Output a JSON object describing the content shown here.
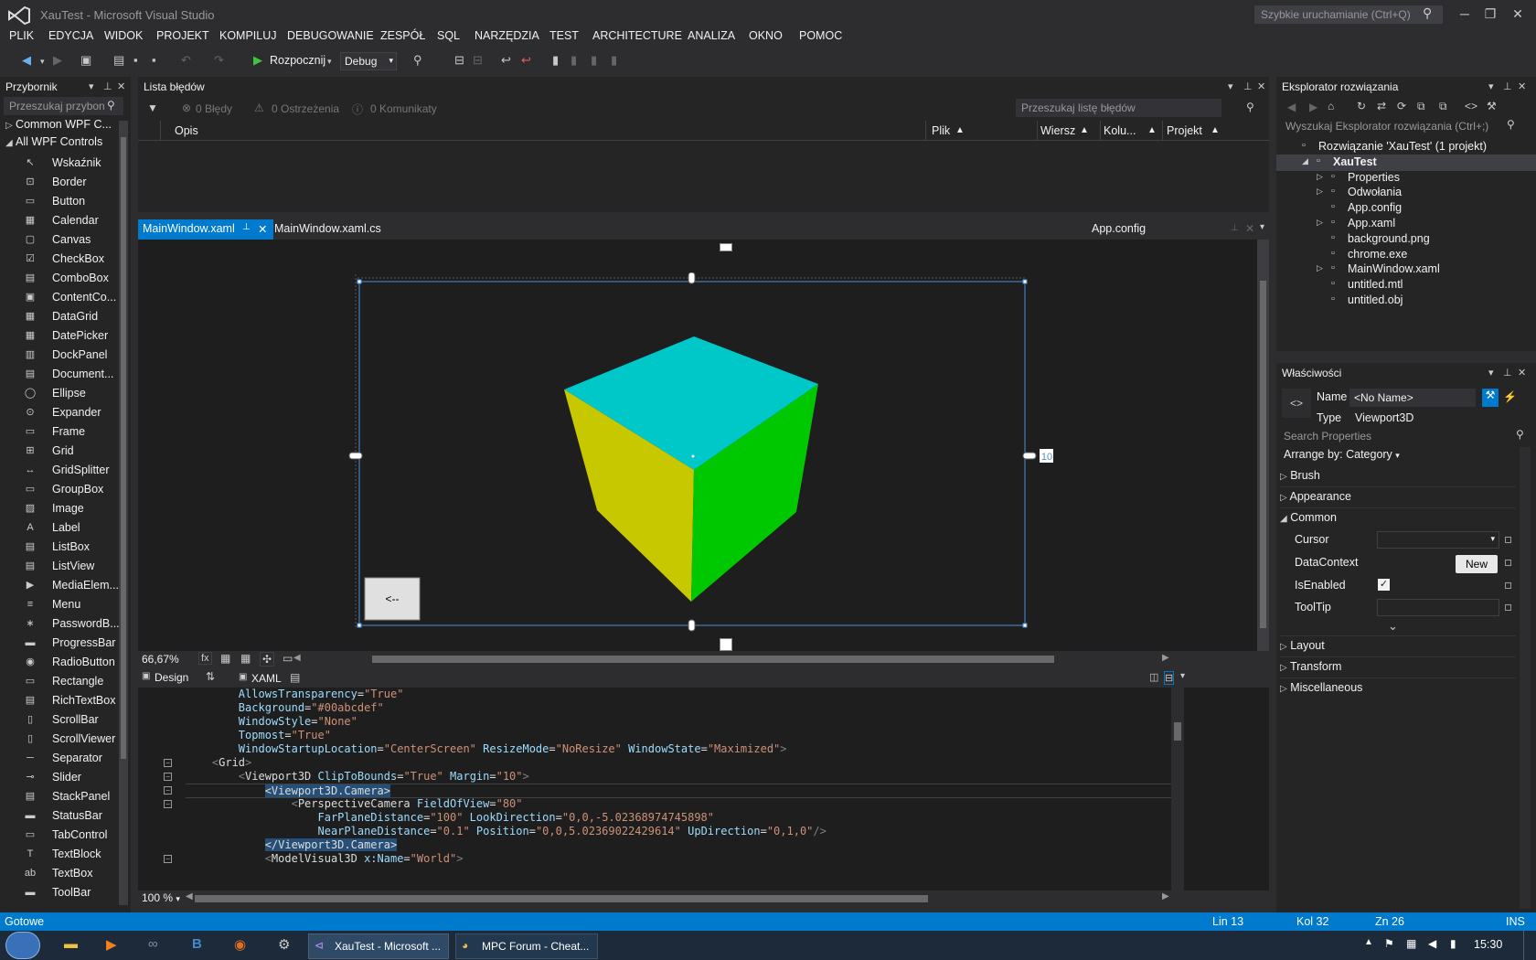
{
  "window": {
    "title": "XauTest - Microsoft Visual Studio",
    "quick_launch": "Szybkie uruchamianie (Ctrl+Q)"
  },
  "menu": [
    "PLIK",
    "EDYCJA",
    "WIDOK",
    "PROJEKT",
    "KOMPILUJ",
    "DEBUGOWANIE",
    "ZESPÓŁ",
    "SQL",
    "NARZĘDZIA",
    "TEST",
    "ARCHITECTURE",
    "ANALIZA",
    "OKNO",
    "POMOC"
  ],
  "toolbar": {
    "start_label": "Rozpocznij",
    "config": "Debug"
  },
  "toolbox": {
    "title": "Przybornik",
    "search_placeholder": "Przeszukaj przybon",
    "groups": [
      "Common WPF C...",
      "All WPF Controls"
    ],
    "items": [
      {
        "label": "Wskaźnik",
        "icon": "pointer-icon",
        "glyph": "↖"
      },
      {
        "label": "Border",
        "icon": "border-icon",
        "glyph": "⊡"
      },
      {
        "label": "Button",
        "icon": "button-icon",
        "glyph": "▭"
      },
      {
        "label": "Calendar",
        "icon": "calendar-icon",
        "glyph": "▦"
      },
      {
        "label": "Canvas",
        "icon": "canvas-icon",
        "glyph": "▢"
      },
      {
        "label": "CheckBox",
        "icon": "checkbox-icon",
        "glyph": "☑"
      },
      {
        "label": "ComboBox",
        "icon": "combobox-icon",
        "glyph": "▤"
      },
      {
        "label": "ContentCo...",
        "icon": "contentcontrol-icon",
        "glyph": "▣"
      },
      {
        "label": "DataGrid",
        "icon": "datagrid-icon",
        "glyph": "▦"
      },
      {
        "label": "DatePicker",
        "icon": "datepicker-icon",
        "glyph": "▦"
      },
      {
        "label": "DockPanel",
        "icon": "dockpanel-icon",
        "glyph": "▥"
      },
      {
        "label": "Document...",
        "icon": "document-icon",
        "glyph": "▤"
      },
      {
        "label": "Ellipse",
        "icon": "ellipse-icon",
        "glyph": "◯"
      },
      {
        "label": "Expander",
        "icon": "expander-icon",
        "glyph": "⊙"
      },
      {
        "label": "Frame",
        "icon": "frame-icon",
        "glyph": "▭"
      },
      {
        "label": "Grid",
        "icon": "grid-icon",
        "glyph": "⊞"
      },
      {
        "label": "GridSplitter",
        "icon": "gridsplitter-icon",
        "glyph": "↔"
      },
      {
        "label": "GroupBox",
        "icon": "groupbox-icon",
        "glyph": "▭"
      },
      {
        "label": "Image",
        "icon": "image-icon",
        "glyph": "▨"
      },
      {
        "label": "Label",
        "icon": "label-icon",
        "glyph": "A"
      },
      {
        "label": "ListBox",
        "icon": "listbox-icon",
        "glyph": "▤"
      },
      {
        "label": "ListView",
        "icon": "listview-icon",
        "glyph": "▤"
      },
      {
        "label": "MediaElem...",
        "icon": "mediaelement-icon",
        "glyph": "▶"
      },
      {
        "label": "Menu",
        "icon": "menu-icon",
        "glyph": "≡"
      },
      {
        "label": "PasswordB...",
        "icon": "passwordbox-icon",
        "glyph": "∗"
      },
      {
        "label": "ProgressBar",
        "icon": "progressbar-icon",
        "glyph": "▬"
      },
      {
        "label": "RadioButton",
        "icon": "radiobutton-icon",
        "glyph": "◉"
      },
      {
        "label": "Rectangle",
        "icon": "rectangle-icon",
        "glyph": "▭"
      },
      {
        "label": "RichTextBox",
        "icon": "richtextbox-icon",
        "glyph": "▤"
      },
      {
        "label": "ScrollBar",
        "icon": "scrollbar-icon",
        "glyph": "▯"
      },
      {
        "label": "ScrollViewer",
        "icon": "scrollviewer-icon",
        "glyph": "▯"
      },
      {
        "label": "Separator",
        "icon": "separator-icon",
        "glyph": "─"
      },
      {
        "label": "Slider",
        "icon": "slider-icon",
        "glyph": "⊸"
      },
      {
        "label": "StackPanel",
        "icon": "stackpanel-icon",
        "glyph": "▤"
      },
      {
        "label": "StatusBar",
        "icon": "statusbar-icon",
        "glyph": "▬"
      },
      {
        "label": "TabControl",
        "icon": "tabcontrol-icon",
        "glyph": "▭"
      },
      {
        "label": "TextBlock",
        "icon": "textblock-icon",
        "glyph": "T"
      },
      {
        "label": "TextBox",
        "icon": "textbox-icon",
        "glyph": "ab"
      },
      {
        "label": "ToolBar",
        "icon": "toolbar-icon",
        "glyph": "▬"
      }
    ]
  },
  "error_list": {
    "title": "Lista błędów",
    "errors": "0 Błędy",
    "warnings": "0 Ostrzeżenia",
    "messages": "0 Komunikaty",
    "search_placeholder": "Przeszukaj listę błędów",
    "columns": [
      "Opis",
      "Plik",
      "Wiersz",
      "Kolu...",
      "Projekt"
    ]
  },
  "tabs": {
    "active": "MainWindow.xaml",
    "second": "MainWindow.xaml.cs",
    "right": "App.config"
  },
  "designer": {
    "margin_left": "10",
    "margin_right": "10",
    "button_label": "<--",
    "zoom": "66,67%"
  },
  "colors": {
    "cube_top": "#00c8c8",
    "cube_left": "#c8c800",
    "cube_right": "#00c800",
    "accent": "#007acc"
  },
  "split": {
    "design": "Design",
    "xaml": "XAML"
  },
  "xaml_lines": [
    [
      [
        "a",
        "        AllowsTransparency"
      ],
      [
        "t",
        "="
      ],
      [
        "v",
        "\"True\""
      ]
    ],
    [
      [
        "a",
        "        Background"
      ],
      [
        "t",
        "="
      ],
      [
        "v",
        "\"#00abcdef\""
      ]
    ],
    [
      [
        "a",
        "        WindowStyle"
      ],
      [
        "t",
        "="
      ],
      [
        "v",
        "\"None\""
      ]
    ],
    [
      [
        "a",
        "        Topmost"
      ],
      [
        "t",
        "="
      ],
      [
        "v",
        "\"True\""
      ]
    ],
    [
      [
        "a",
        "        WindowStartupLocation"
      ],
      [
        "t",
        "="
      ],
      [
        "v",
        "\"CenterScreen\""
      ],
      [
        "a",
        " ResizeMode"
      ],
      [
        "t",
        "="
      ],
      [
        "v",
        "\"NoResize\""
      ],
      [
        "a",
        " WindowState"
      ],
      [
        "t",
        "="
      ],
      [
        "v",
        "\"Maximized\""
      ],
      [
        "g",
        ">"
      ]
    ],
    [
      [
        "g",
        "    <"
      ],
      [
        "e",
        "Grid"
      ],
      [
        "g",
        ">"
      ]
    ],
    [
      [
        "g",
        "        <"
      ],
      [
        "e",
        "Viewport3D"
      ],
      [
        "a",
        " ClipToBounds"
      ],
      [
        "t",
        "="
      ],
      [
        "v",
        "\"True\""
      ],
      [
        "a",
        " Margin"
      ],
      [
        "t",
        "="
      ],
      [
        "v",
        "\"10\""
      ],
      [
        "g",
        ">"
      ]
    ],
    [
      [
        "s",
        "            <Viewport3D.Camera>"
      ]
    ],
    [
      [
        "g",
        "                <"
      ],
      [
        "e",
        "PerspectiveCamera"
      ],
      [
        "a",
        " FieldOfView"
      ],
      [
        "t",
        "="
      ],
      [
        "v",
        "\"80\""
      ]
    ],
    [
      [
        "a",
        "                    FarPlaneDistance"
      ],
      [
        "t",
        "="
      ],
      [
        "v",
        "\"100\""
      ],
      [
        "a",
        " LookDirection"
      ],
      [
        "t",
        "="
      ],
      [
        "v",
        "\"0,0,-5.02368974745898\""
      ]
    ],
    [
      [
        "a",
        "                    NearPlaneDistance"
      ],
      [
        "t",
        "="
      ],
      [
        "v",
        "\"0.1\""
      ],
      [
        "a",
        " Position"
      ],
      [
        "t",
        "="
      ],
      [
        "v",
        "\"0,0,5.02369022429614\""
      ],
      [
        "a",
        " UpDirection"
      ],
      [
        "t",
        "="
      ],
      [
        "v",
        "\"0,1,0\""
      ],
      [
        "g",
        "/>"
      ]
    ],
    [
      [
        "s",
        "            </Viewport3D.Camera>"
      ]
    ],
    [
      [
        "g",
        "            <"
      ],
      [
        "e",
        "ModelVisual3D"
      ],
      [
        "a",
        " x:Name"
      ],
      [
        "t",
        "="
      ],
      [
        "v",
        "\"World\""
      ],
      [
        "g",
        ">"
      ]
    ]
  ],
  "xaml_zoom": "100 %",
  "solution": {
    "title": "Eksplorator rozwiązania",
    "search_placeholder": "Wyszukaj Eksplorator rozwiązania (Ctrl+;)",
    "items": [
      {
        "label": "Rozwiązanie 'XauTest' (1 projekt)",
        "icon": "solution-icon",
        "indent": 0,
        "exp": ""
      },
      {
        "label": "XauTest",
        "icon": "csharp-project-icon",
        "indent": 1,
        "exp": "◢"
      },
      {
        "label": "Properties",
        "icon": "wrench-icon",
        "indent": 2,
        "exp": "▷"
      },
      {
        "label": "Odwołania",
        "icon": "references-icon",
        "indent": 2,
        "exp": "▷"
      },
      {
        "label": "App.config",
        "icon": "config-file-icon",
        "indent": 2,
        "exp": ""
      },
      {
        "label": "App.xaml",
        "icon": "xaml-file-icon",
        "indent": 2,
        "exp": "▷"
      },
      {
        "label": "background.png",
        "icon": "image-file-icon",
        "indent": 2,
        "exp": ""
      },
      {
        "label": "chrome.exe",
        "icon": "file-icon",
        "indent": 2,
        "exp": ""
      },
      {
        "label": "MainWindow.xaml",
        "icon": "xaml-file-icon",
        "indent": 2,
        "exp": "▷"
      },
      {
        "label": "untitled.mtl",
        "icon": "file-icon",
        "indent": 2,
        "exp": ""
      },
      {
        "label": "untitled.obj",
        "icon": "obj-file-icon",
        "indent": 2,
        "exp": ""
      }
    ]
  },
  "properties": {
    "title": "Właściwości",
    "name_label": "Name",
    "name_value": "<No Name>",
    "type_label": "Type",
    "type_value": "Viewport3D",
    "search_placeholder": "Search Properties",
    "arrange": "Arrange by: Category",
    "categories_top": [
      "Brush",
      "Appearance"
    ],
    "common": "Common",
    "rows": [
      "Cursor",
      "DataContext",
      "IsEnabled",
      "ToolTip"
    ],
    "new_label": "New",
    "categories_bottom": [
      "Layout",
      "Transform",
      "Miscellaneous"
    ]
  },
  "status": {
    "ready": "Gotowe",
    "line": "Lin 13",
    "col": "Kol 32",
    "ch": "Zn 26",
    "mode": "INS"
  },
  "taskbar": {
    "vs": "XauTest - Microsoft ...",
    "chrome": "MPC Forum - Cheat...",
    "clock": "15:30"
  }
}
